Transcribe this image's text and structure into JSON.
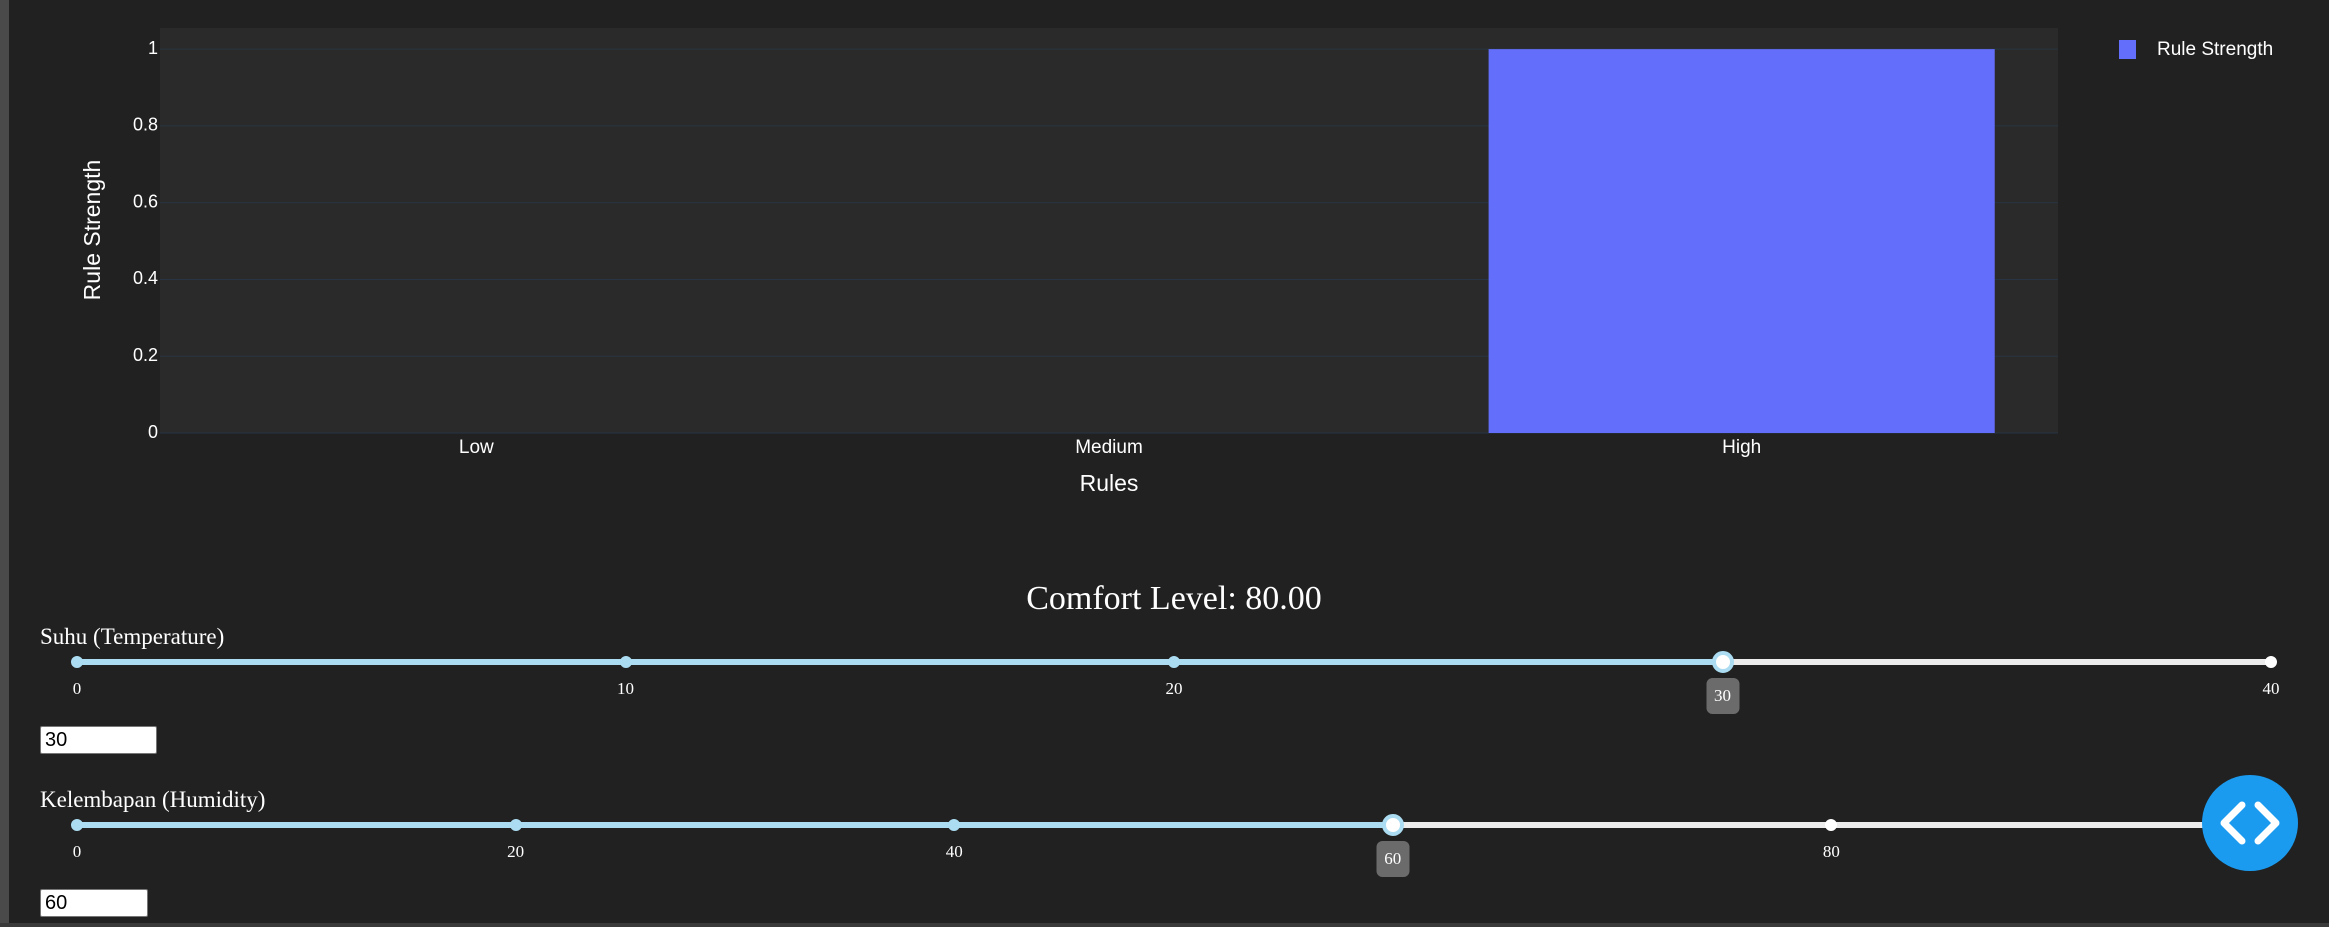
{
  "chart_data": {
    "type": "bar",
    "categories": [
      "Low",
      "Medium",
      "High"
    ],
    "series": [
      {
        "name": "Rule Strength",
        "values": [
          0,
          0,
          1
        ]
      }
    ],
    "xlabel": "Rules",
    "ylabel": "Rule Strength",
    "ylim": [
      0,
      1.055
    ],
    "yticks": [
      0,
      0.2,
      0.4,
      0.6,
      0.8,
      1
    ],
    "ytick_labels": [
      "0",
      "0.2",
      "0.4",
      "0.6",
      "0.8",
      "1"
    ],
    "grid": true,
    "legend": "top-right",
    "colors": {
      "bar": "#636efa",
      "plot_bg": "#2a2a2a",
      "paper_bg": "#212121",
      "grid": "#283442"
    }
  },
  "comfort": {
    "text": "Comfort Level: 80.00"
  },
  "sliders": [
    {
      "id": "temperature",
      "label": "Suhu (Temperature)",
      "min": 0,
      "max": 40,
      "value": 30,
      "marks": [
        0,
        10,
        20,
        30,
        40
      ],
      "mark_labels": [
        "0",
        "10",
        "20",
        "",
        "40"
      ],
      "tooltip": "30",
      "input_value": "30"
    },
    {
      "id": "humidity",
      "label": "Kelembapan (Humidity)",
      "min": 0,
      "max": 100,
      "value": 60,
      "marks": [
        0,
        20,
        40,
        60,
        80
      ],
      "mark_labels": [
        "0",
        "20",
        "40",
        "",
        "80"
      ],
      "tooltip": "60",
      "input_value": "60"
    }
  ],
  "fab": {
    "icon": "code-icon"
  }
}
